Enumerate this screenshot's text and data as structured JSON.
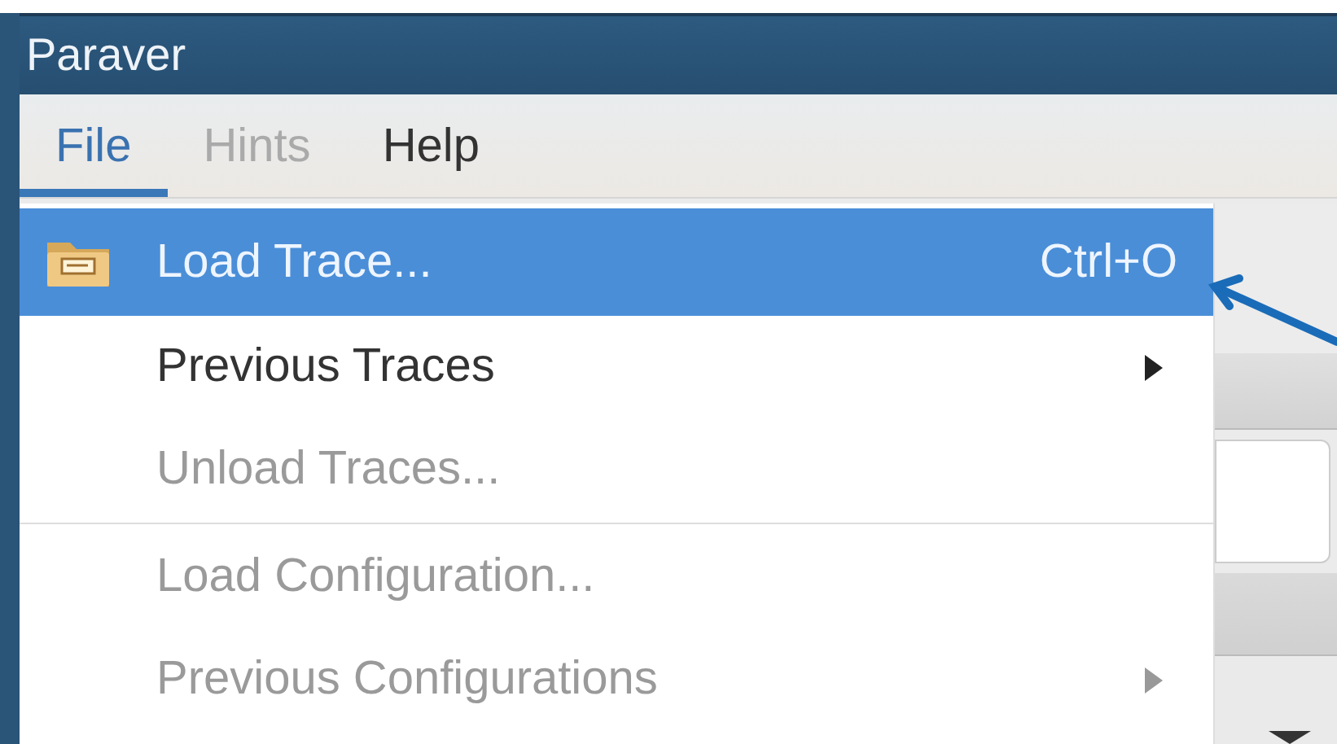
{
  "window": {
    "title": "Paraver"
  },
  "menubar": [
    {
      "label": "File",
      "selected": true,
      "disabled": false
    },
    {
      "label": "Hints",
      "selected": false,
      "disabled": true
    },
    {
      "label": "Help",
      "selected": false,
      "disabled": false
    }
  ],
  "menu": [
    {
      "kind": "item",
      "label": "Load Trace...",
      "shortcut": "Ctrl+O",
      "selected": true,
      "disabled": false,
      "submenu": false
    },
    {
      "kind": "item",
      "label": "Previous Traces",
      "selected": false,
      "disabled": false,
      "submenu": true
    },
    {
      "kind": "item",
      "label": "Unload Traces...",
      "selected": false,
      "disabled": true,
      "submenu": false
    },
    {
      "kind": "separator"
    },
    {
      "kind": "item",
      "label": "Load Configuration...",
      "selected": false,
      "disabled": true,
      "submenu": false
    },
    {
      "kind": "item",
      "label": "Previous Configurations",
      "selected": false,
      "disabled": true,
      "submenu": true
    }
  ]
}
